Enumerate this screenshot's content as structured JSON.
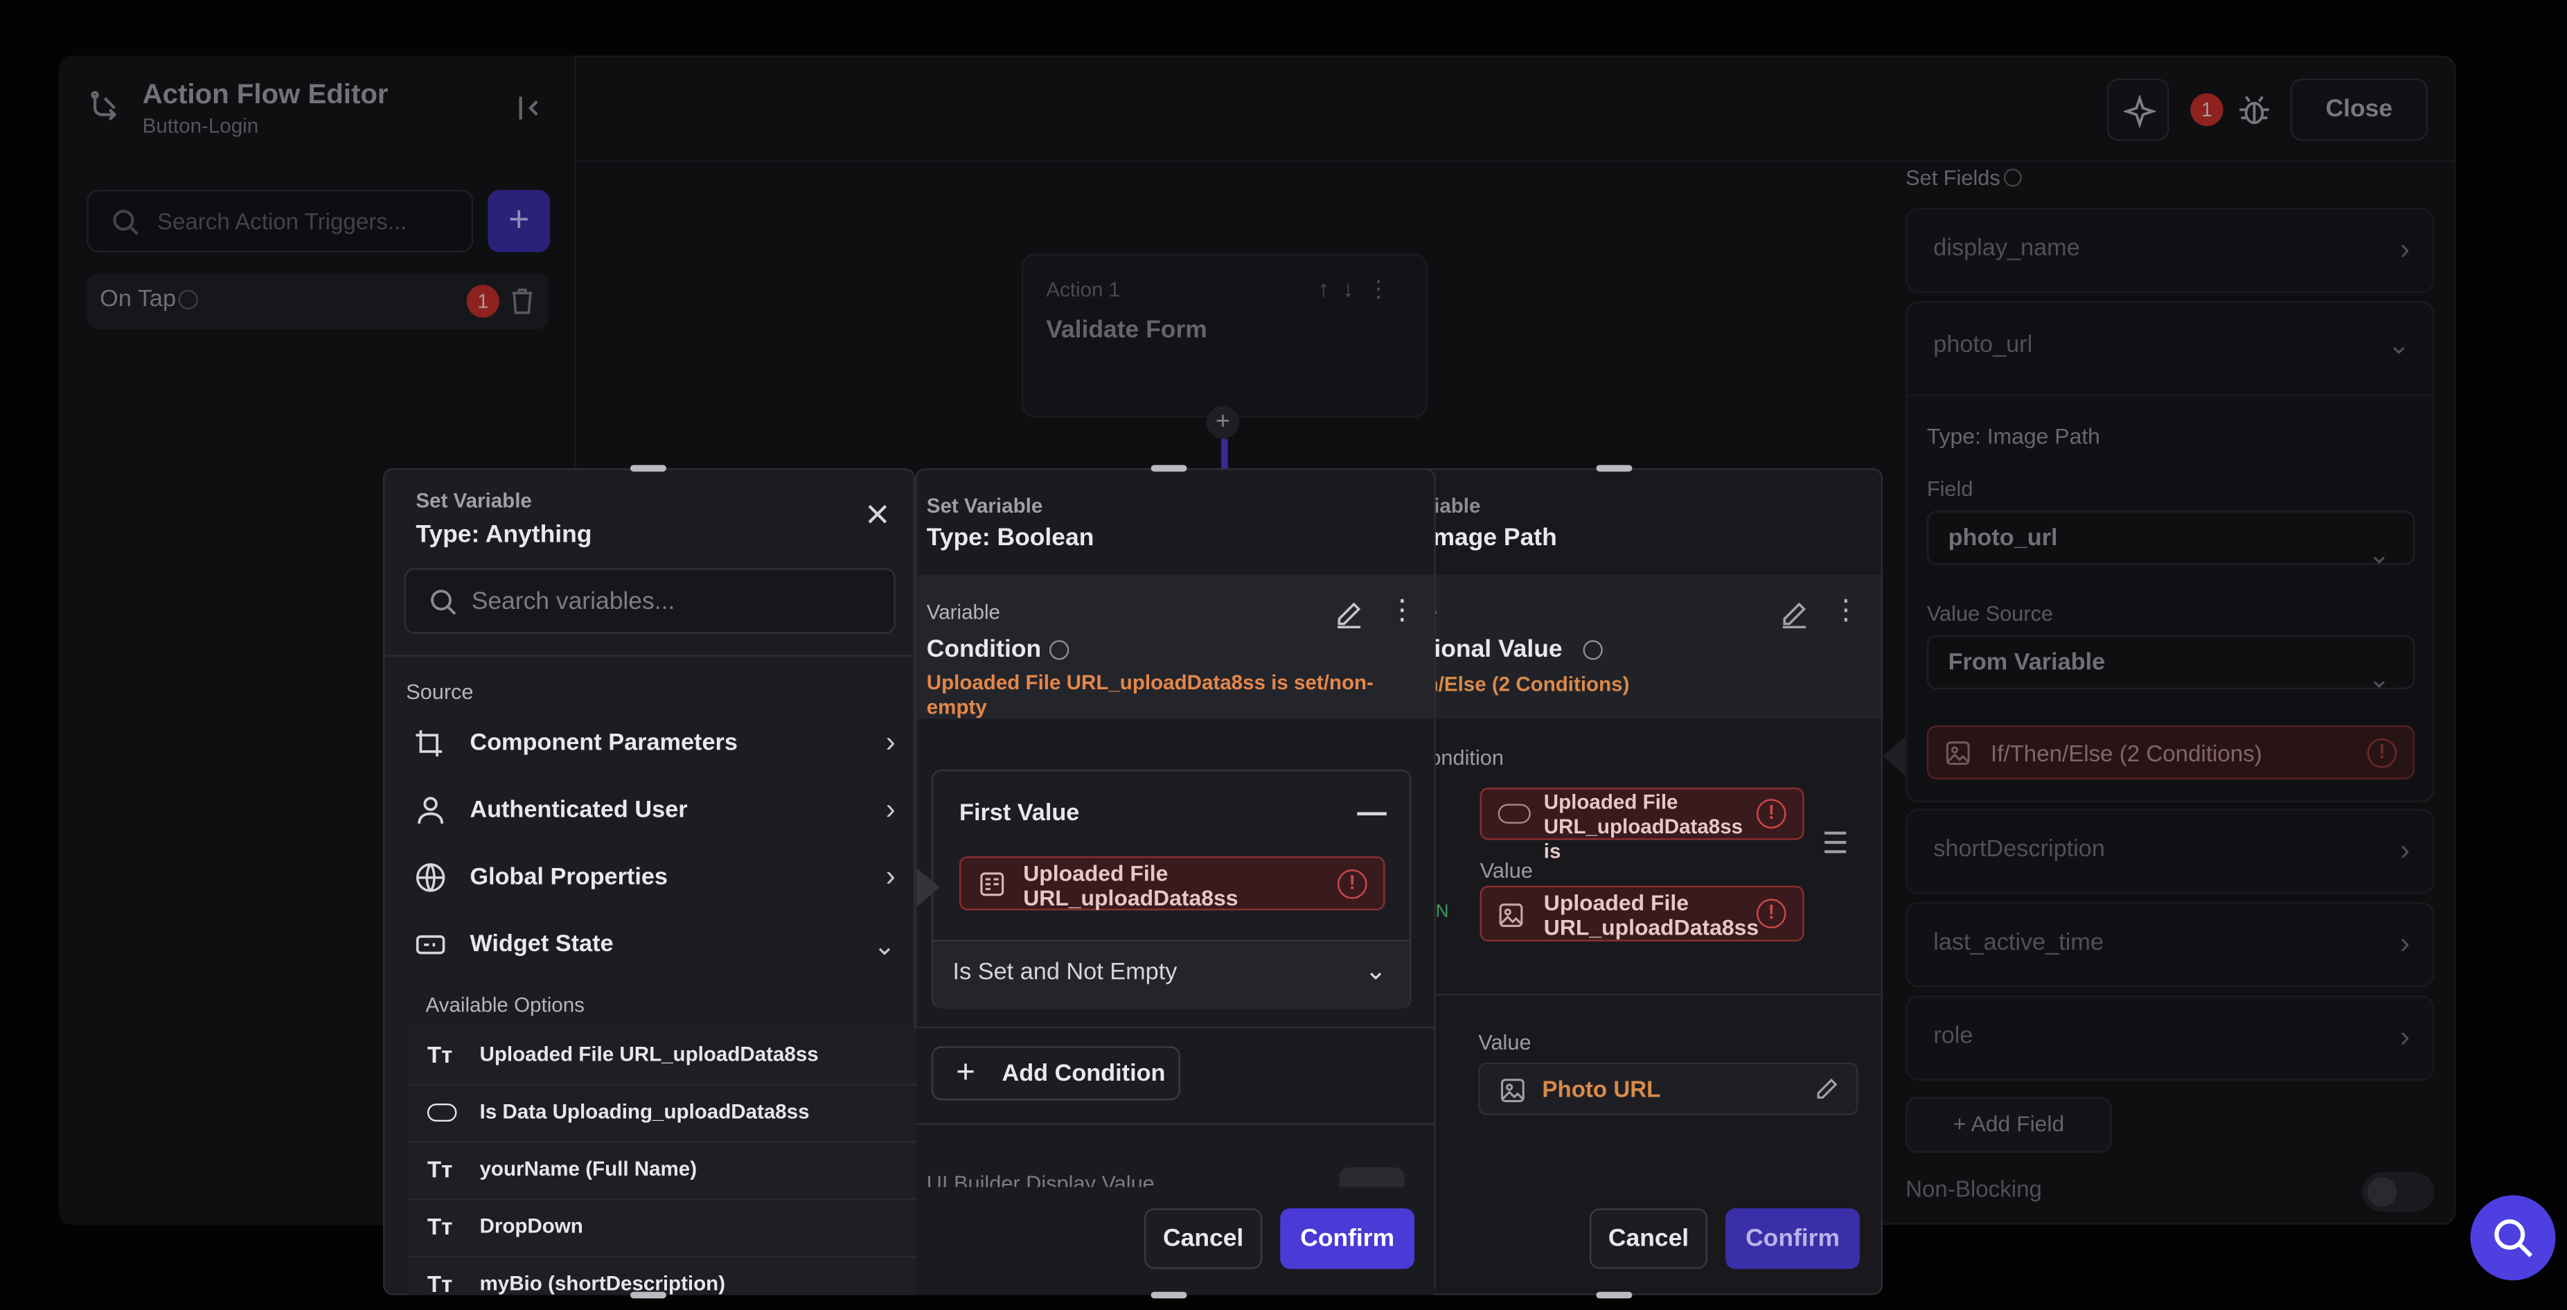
{
  "editor": {
    "title": "Action Flow Editor",
    "subtitle": "Button-Login",
    "close_label": "Close",
    "issue_count": "1"
  },
  "triggers": {
    "search_placeholder": "Search Action Triggers...",
    "add_label": "+",
    "items": [
      {
        "label": "On Tap",
        "badge": "1"
      }
    ]
  },
  "canvas": {
    "action_number": "Action 1",
    "action_name": "Validate Form",
    "add_node": "+"
  },
  "set_fields": {
    "title": "Set Fields",
    "fields": [
      "display_name",
      "photo_url",
      "shortDescription",
      "last_active_time",
      "role"
    ],
    "photo_url": {
      "type_label": "Type: Image Path",
      "field_label": "Field",
      "field_value": "photo_url",
      "source_label": "Value Source",
      "source_value": "From Variable",
      "chip": "If/Then/Else (2 Conditions)"
    },
    "add_field_label": "+  Add Field",
    "non_blocking_label": "Non-Blocking"
  },
  "dialog_variable": {
    "subtitle": "Set Variable",
    "title": "Type: Anything",
    "search_placeholder": "Search variables...",
    "source_label": "Source",
    "sources": [
      {
        "label": "Component Parameters",
        "icon": "component-icon"
      },
      {
        "label": "Authenticated User",
        "icon": "user-icon"
      },
      {
        "label": "Global Properties",
        "icon": "globe-icon"
      },
      {
        "label": "Widget State",
        "icon": "widget-icon"
      }
    ],
    "available_label": "Available Options",
    "options": [
      {
        "label": "Uploaded File URL_uploadData8ss",
        "icon": "text-icon"
      },
      {
        "label": "Is Data Uploading_uploadData8ss",
        "icon": "toggle-icon"
      },
      {
        "label": "yourName (Full Name)",
        "icon": "text-icon"
      },
      {
        "label": "DropDown",
        "icon": "text-icon"
      },
      {
        "label": "myBio (shortDescription)",
        "icon": "text-icon"
      }
    ]
  },
  "dialog_boolean": {
    "subtitle": "Set Variable",
    "title": "Type: Boolean",
    "variable_label": "Variable",
    "variable_name": "Condition",
    "variable_desc": "Uploaded File URL_uploadData8ss is set/non-empty",
    "first_value_label": "First Value",
    "chip": "Uploaded File URL_uploadData8ss",
    "operator": "Is Set and Not Empty",
    "add_condition": "Add Condition",
    "ui_display_label": "UI Builder Display Value",
    "cancel": "Cancel",
    "confirm": "Confirm"
  },
  "dialog_image": {
    "subtitle": "riable",
    "title": "Image Path",
    "variable_label": "e",
    "variable_name": "tional Value",
    "variable_desc": "n/Else (2 Conditions)",
    "condition_label": "ondition",
    "cond_chip": "Uploaded File URL_uploadData8ss is",
    "value_label": "Value",
    "value_chip": "Uploaded File URL_uploadData8ss",
    "n_label": "N",
    "value2_label": "Value",
    "photo_url_label": "Photo URL",
    "cancel": "Cancel",
    "confirm": "Confirm"
  }
}
